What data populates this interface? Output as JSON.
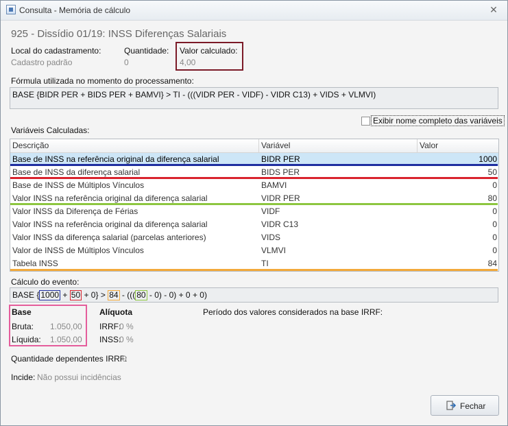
{
  "window": {
    "title": "Consulta - Memória de cálculo"
  },
  "heading": "925 - Dissídio 01/19: INSS Diferenças Salariais",
  "info": {
    "local_label": "Local do cadastramento:",
    "local_value": "Cadastro padrão",
    "quantidade_label": "Quantidade:",
    "quantidade_value": "0",
    "valor_label": "Valor calculado:",
    "valor_value": "4,00"
  },
  "formula": {
    "label": "Fórmula utilizada no momento do processamento:",
    "text": "BASE {BIDR PER + BIDS PER + BAMVI} > TI - (((VIDR PER - VIDF) - VIDR C13) + VIDS + VLMVI)"
  },
  "checkbox": {
    "label": "Exibir nome completo das variáveis",
    "checked": false
  },
  "variables": {
    "label": "Variáveis Calculadas:",
    "columns": [
      "Descrição",
      "Variável",
      "Valor"
    ],
    "rows": [
      {
        "descricao": "Base de INSS na referência original da diferença salarial",
        "variavel": "BIDR PER",
        "valor": "1000"
      },
      {
        "descricao": "Base de INSS da diferença salarial",
        "variavel": "BIDS PER",
        "valor": "50"
      },
      {
        "descricao": "Base de INSS de Múltiplos Vínculos",
        "variavel": "BAMVI",
        "valor": "0"
      },
      {
        "descricao": "Valor INSS na referência original da diferença salarial",
        "variavel": "VIDR PER",
        "valor": "80"
      },
      {
        "descricao": "Valor INSS da Diferença de Férias",
        "variavel": "VIDF",
        "valor": "0"
      },
      {
        "descricao": "Valor INSS na referência original da diferença salarial",
        "variavel": "VIDR C13",
        "valor": "0"
      },
      {
        "descricao": "Valor INSS da diferença salarial (parcelas anteriores)",
        "variavel": "VIDS",
        "valor": "0"
      },
      {
        "descricao": "Valor de INSS de Múltiplos Vínculos",
        "variavel": "VLMVI",
        "valor": "0"
      },
      {
        "descricao": "Tabela INSS",
        "variavel": "TI",
        "valor": "84"
      }
    ]
  },
  "calculo": {
    "label": "Cálculo do evento:",
    "p1": "BASE {",
    "v1": "1000",
    "p2": "+",
    "v2": "50",
    "p3": "+ 0} >",
    "v3": "84",
    "p4": "- (((",
    "v4": "80",
    "p5": "- 0) - 0) + 0 + 0)"
  },
  "base": {
    "title": "Base",
    "bruta_label": "Bruta:",
    "bruta_value": "1.050,00",
    "liquida_label": "Líquida:",
    "liquida_value": "1.050,00"
  },
  "aliquota": {
    "title": "Alíquota",
    "irrf_label": "IRRF:",
    "irrf_value": "0 %",
    "inss_label": "INSS:",
    "inss_value": "0 %"
  },
  "periodo_label": "Período dos valores considerados na base IRRF:",
  "dependentes": {
    "label": "Quantidade dependentes IRRF:",
    "value": "0"
  },
  "incide": {
    "label": "Incide:",
    "value": "Não possui incidências"
  },
  "buttons": {
    "fechar": "Fechar"
  },
  "colors": {
    "highlight_blue": "#1e2ea0",
    "highlight_red": "#d9232d",
    "highlight_green": "#8dc63f",
    "highlight_orange": "#f2a93b",
    "box_darkred": "#7b1a27",
    "box_pink": "#e55d9b"
  },
  "icons": {
    "app": "app-window-icon",
    "close": "close-icon",
    "exit": "exit-door-icon"
  }
}
